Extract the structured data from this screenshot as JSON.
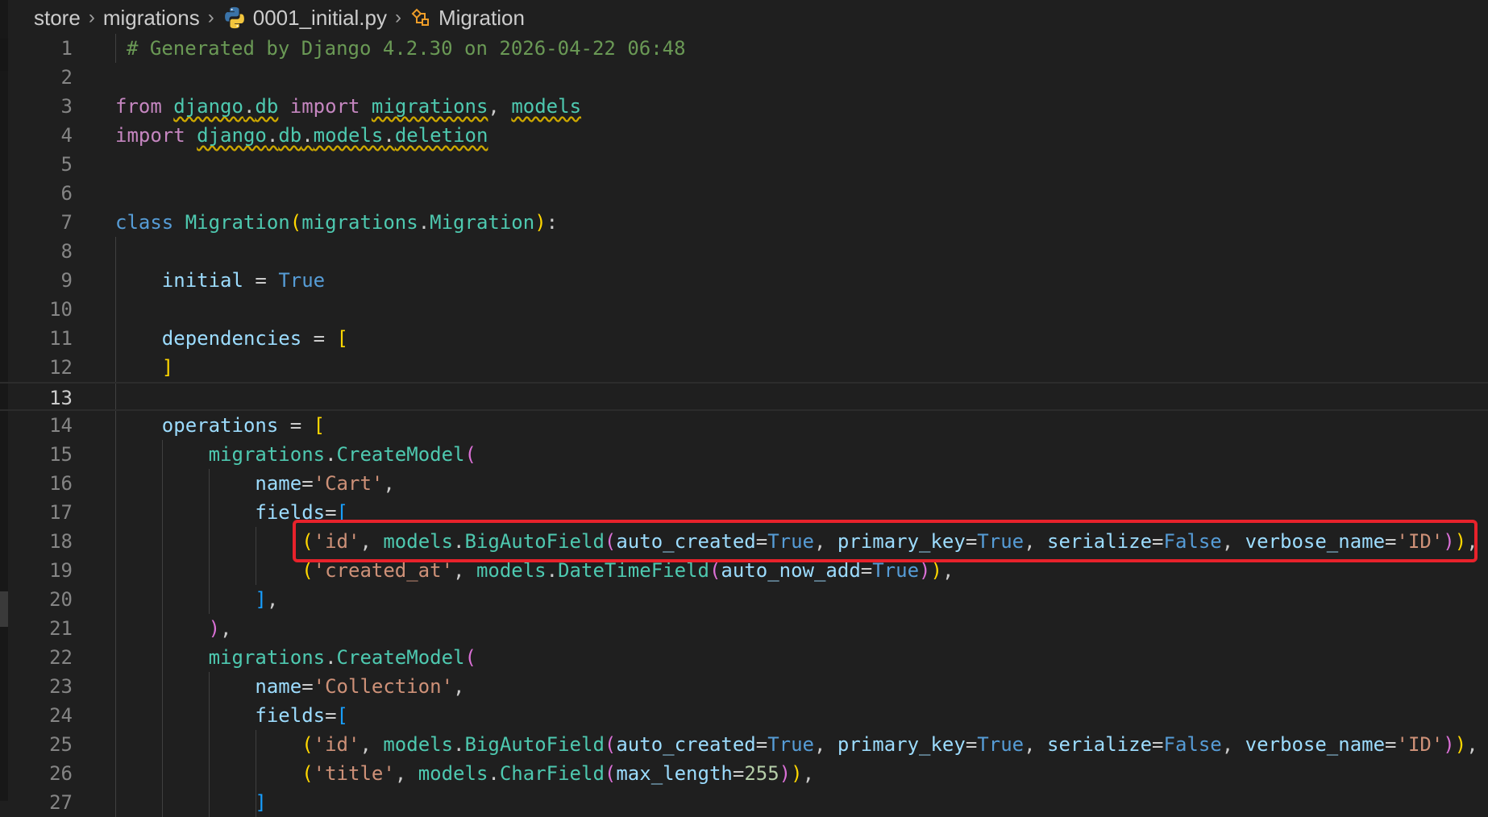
{
  "breadcrumb": {
    "items": [
      "store",
      "migrations",
      "0001_initial.py",
      "Migration"
    ],
    "file_icon": "python-file-icon",
    "symbol_icon": "class-symbol-icon"
  },
  "editor": {
    "active_line": "13",
    "line_numbers": [
      "1",
      "2",
      "3",
      "4",
      "5",
      "6",
      "7",
      "8",
      "9",
      "10",
      "11",
      "12",
      "13",
      "14",
      "15",
      "16",
      "17",
      "18",
      "19",
      "20",
      "21",
      "22",
      "23",
      "24",
      "25",
      "26",
      "27"
    ],
    "t": {
      "l1": "# Generated by Django 4.2.30 on 2026-04-22 06:48",
      "from": "from",
      "import": "import",
      "class": "class",
      "django": "django",
      "db": "db",
      "models": "models",
      "deletion": "deletion",
      "migrations": "migrations",
      "Migration": "Migration",
      "initial": "initial",
      "True": "True",
      "False": "False",
      "dependencies": "dependencies",
      "operations": "operations",
      "CreateModel": "CreateModel",
      "name": "name",
      "fields": "fields",
      "BigAutoField": "BigAutoField",
      "DateTimeField": "DateTimeField",
      "CharField": "CharField",
      "auto_created": "auto_created",
      "primary_key": "primary_key",
      "serialize": "serialize",
      "verbose_name": "verbose_name",
      "auto_now_add": "auto_now_add",
      "max_length": "max_length",
      "s_cart": "'Cart'",
      "s_collection": "'Collection'",
      "s_id": "'id'",
      "s_ID": "'ID'",
      "s_created_at": "'created_at'",
      "s_title": "'title'",
      "n255": "255"
    }
  },
  "colors": {
    "background": "#1f1f1f",
    "highlight_box": "#e8222b"
  }
}
